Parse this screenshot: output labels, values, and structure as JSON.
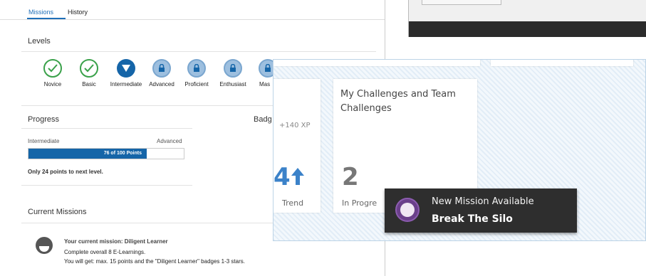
{
  "tabs": [
    {
      "label": "Missions"
    },
    {
      "label": "History"
    }
  ],
  "levels": {
    "title": "Levels",
    "items": [
      {
        "label": "Novice",
        "state": "done"
      },
      {
        "label": "Basic",
        "state": "done"
      },
      {
        "label": "Intermediate",
        "state": "current"
      },
      {
        "label": "Advanced",
        "state": "locked"
      },
      {
        "label": "Proficient",
        "state": "locked"
      },
      {
        "label": "Enthusiast",
        "state": "locked"
      },
      {
        "label": "Mas",
        "state": "locked"
      }
    ]
  },
  "progress": {
    "title": "Progress",
    "current_level": "Intermediate",
    "next_level": "Advanced",
    "bar_text": "76 of 100 Points",
    "points": 76,
    "points_max": 100,
    "note": "Only 24 points to next level."
  },
  "badges": {
    "title": "Badg"
  },
  "current_missions": {
    "title": "Current Missions",
    "headline": "Your current mission: Diligent Learner",
    "line1": "Complete overall 8 E-Learnings.",
    "line2": "You will get: max. 15 points and the \"Diligent Learner\" badges 1-3 stars."
  },
  "overlay": {
    "xp": "+140 XP",
    "trend_value": "4",
    "trend_label": "Trend",
    "card_title": "My Challenges and Team Challenges",
    "in_progress_value": "2",
    "in_progress_label": "In Progre"
  },
  "toast": {
    "title": "New Mission Available",
    "mission": "Break The Silo"
  },
  "colors": {
    "accent": "#1565a8",
    "done_green": "#3aa14a",
    "trend_blue": "#3b82c9",
    "toast_bg": "#2e2e2e"
  }
}
